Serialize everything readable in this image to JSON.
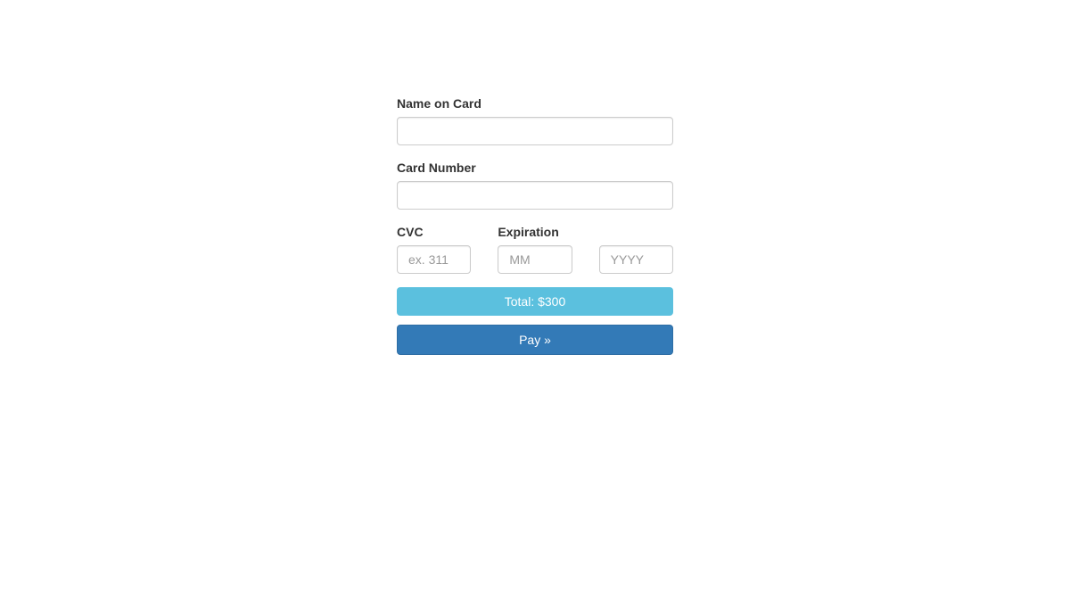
{
  "form": {
    "name_label": "Name on Card",
    "name_value": "",
    "card_number_label": "Card Number",
    "card_number_value": "",
    "cvc_label": "CVC",
    "cvc_placeholder": "ex. 311",
    "cvc_value": "",
    "expiration_label": "Expiration",
    "month_placeholder": "MM",
    "month_value": "",
    "year_placeholder": "YYYY",
    "year_value": "",
    "total_text": "Total: $300",
    "pay_button_text": "Pay »"
  }
}
